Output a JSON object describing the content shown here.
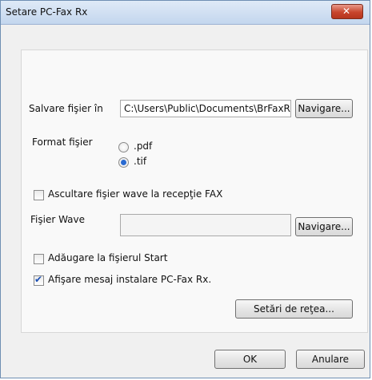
{
  "window": {
    "title": "Setare PC-Fax Rx"
  },
  "save_folder": {
    "label": "Salvare fişier în",
    "value": "C:\\Users\\Public\\Documents\\BrFaxRx",
    "browse_label": "Navigare..."
  },
  "file_format": {
    "label": "Format fişier",
    "options": [
      ".pdf",
      ".tif"
    ],
    "selected": ".tif"
  },
  "wave": {
    "play_label": "Ascultare fişier wave la recepţie FAX",
    "play_checked": false,
    "file_label": "Fişier Wave",
    "file_value": "",
    "browse_label": "Navigare..."
  },
  "startup": {
    "label": "Adăugare la fişierul Start",
    "checked": false
  },
  "show_message": {
    "label": "Afişare mesaj instalare PC-Fax Rx.",
    "checked": true
  },
  "network_button": "Setări de reţea...",
  "footer": {
    "ok": "OK",
    "cancel": "Anulare"
  }
}
